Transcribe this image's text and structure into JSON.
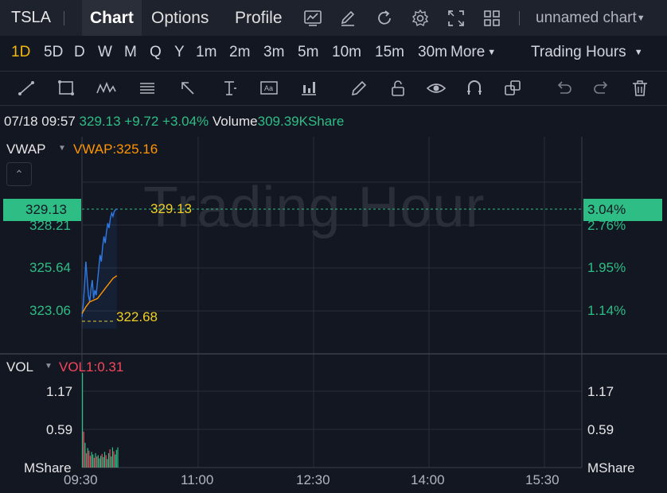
{
  "topbar": {
    "symbol": "TSLA",
    "tabs": [
      "Chart",
      "Options",
      "Profile"
    ],
    "active_tab": "Chart",
    "chart_name": "unnamed chart",
    "icons": [
      "screenshot-chart-icon",
      "edit-icon",
      "refresh-icon",
      "settings-icon",
      "fullscreen-icon",
      "layout-grid-icon"
    ]
  },
  "periods": {
    "items": [
      "1D",
      "5D",
      "D",
      "W",
      "M",
      "Q",
      "Y",
      "1m",
      "2m",
      "3m",
      "5m",
      "10m",
      "15m",
      "30m"
    ],
    "active": "1D",
    "more": "More",
    "session": "Trading Hours"
  },
  "toolbar": {
    "tools": [
      "trend-line-icon",
      "rectangle-icon",
      "pattern-icon",
      "fib-icon",
      "arrow-icon",
      "measure-icon",
      "text-note-icon",
      "indicator-icon",
      "brush-icon",
      "lock-icon",
      "visibility-icon",
      "magnet-icon",
      "layers-icon",
      "undo-icon",
      "redo-icon",
      "delete-icon"
    ]
  },
  "quote": {
    "datetime": "07/18 09:57",
    "price": "329.13",
    "change": "+9.72",
    "change_pct": "+3.04%",
    "volume_label": "Volume",
    "volume": "309.39KShare"
  },
  "main_panel": {
    "indicator": "VWAP",
    "indicator_value": "VWAP:325.16",
    "watermark": "Trading Hour",
    "current_price_tag": "329.13",
    "current_pct_tag": "3.04%",
    "high_label": "329.13",
    "low_label": "322.68",
    "left_axis": [
      "328.21",
      "325.64",
      "323.06"
    ],
    "right_axis": [
      "2.76%",
      "1.95%",
      "1.14%"
    ]
  },
  "vol_panel": {
    "indicator": "VOL",
    "indicator_value": "VOL1:0.31",
    "left_axis": [
      "1.17",
      "0.59",
      "MShare"
    ],
    "right_axis": [
      "1.17",
      "0.59",
      "MShare"
    ]
  },
  "time_axis": [
    "09:30",
    "11:00",
    "12:30",
    "14:00",
    "15:30"
  ],
  "colors": {
    "up": "#2ebd85",
    "down": "#f6465d",
    "accent": "#f0b90b",
    "vwap": "#ff9500",
    "price_line": "#2f7ae5"
  },
  "chart_data": {
    "type": "line",
    "series": [
      {
        "name": "VWAP",
        "x": [
          "09:30",
          "09:33",
          "09:36",
          "09:39",
          "09:42",
          "09:45",
          "09:48",
          "09:51",
          "09:54",
          "09:57"
        ],
        "values": [
          322.9,
          323.3,
          323.6,
          323.7,
          323.8,
          324.1,
          324.4,
          324.7,
          325.0,
          325.16
        ]
      },
      {
        "x": [
          "09:30",
          "09:31",
          "09:32",
          "09:33",
          "09:34",
          "09:35",
          "09:36",
          "09:37",
          "09:38",
          "09:39",
          "09:40",
          "09:41",
          "09:42",
          "09:43",
          "09:44",
          "09:45",
          "09:46",
          "09:47",
          "09:48",
          "09:49",
          "09:50",
          "09:51",
          "09:52",
          "09:53",
          "09:54",
          "09:55",
          "09:56",
          "09:57"
        ],
        "values": [
          322.7,
          323.5,
          324.6,
          326.0,
          325.0,
          324.0,
          323.6,
          324.4,
          324.9,
          323.8,
          324.3,
          324.0,
          324.8,
          325.6,
          326.4,
          326.0,
          326.9,
          327.5,
          327.1,
          327.8,
          328.3,
          328.0,
          328.6,
          328.9,
          328.7,
          329.0,
          329.1,
          329.13
        ]
      }
    ],
    "ylim": [
      322.0,
      330.5
    ],
    "volume": {
      "x_count": 28,
      "values": [
        1.45,
        0.55,
        0.38,
        0.22,
        0.3,
        0.26,
        0.18,
        0.24,
        0.2,
        0.15,
        0.22,
        0.17,
        0.19,
        0.14,
        0.18,
        0.21,
        0.16,
        0.24,
        0.19,
        0.13,
        0.22,
        0.28,
        0.17,
        0.31,
        0.25,
        0.2,
        0.27,
        0.31
      ],
      "up": [
        true,
        false,
        true,
        false,
        true,
        false,
        false,
        true,
        true,
        false,
        true,
        false,
        true,
        true,
        true,
        false,
        true,
        true,
        false,
        true,
        true,
        false,
        true,
        true,
        false,
        true,
        true,
        true
      ],
      "ylim": [
        0,
        1.5
      ]
    }
  }
}
